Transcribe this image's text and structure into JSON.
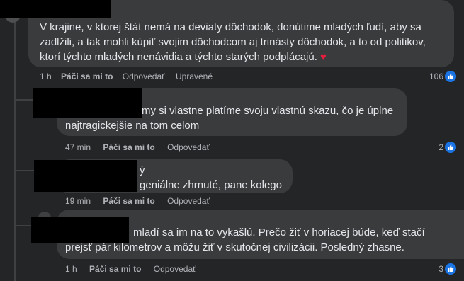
{
  "colors": {
    "background": "#242526",
    "bubble": "#3a3b3c",
    "text": "#e4e6eb",
    "meta_text": "#b0b3b8",
    "like_blue": "#1b74e4",
    "heart": "#e41e3f"
  },
  "comments": [
    {
      "lines": [
        "V krajine, v ktorej štát nemá na deviaty dôchodok, donútime mladých ľudí, aby sa",
        "zadlžili, a tak mohli kúpiť svojim dôchodcom aj trinásty dôchodok, a to od politikov,",
        "ktorí týchto mladých nenávidia a týchto starých podplácajú."
      ],
      "emoji": "♥",
      "time": "1 h",
      "like": "Páči sa mi to",
      "reply": "Odpovedať",
      "edited": "Upravené",
      "reactions": "106",
      "reaction_icon": "like-icon"
    },
    {
      "lines": [
        "my si vlastne platíme svoju vlastnú skazu, čo je úplne",
        "najtragickejšie na tom celom"
      ],
      "time": "47 min",
      "like": "Páči sa mi to",
      "reply": "Odpovedať",
      "reactions": "2",
      "reaction_icon": "like-icon"
    },
    {
      "lines": [
        "ý",
        "geniálne zhrnuté, pane kolego"
      ],
      "time": "19 min",
      "like": "Páči sa mi to",
      "reply": "Odpovedať"
    },
    {
      "lines": [
        "mladí sa im na to vykašlú. Prečo žiť v horiacej búde, keď stačí",
        "prejsť pár kilometrov a môžu žiť v skutočnej civilizácii. Posledný zhasne."
      ],
      "time": "1 h",
      "like": "Páči sa mi to",
      "reply": "Odpovedať",
      "reactions": "3",
      "reaction_icon": "like-icon"
    }
  ]
}
